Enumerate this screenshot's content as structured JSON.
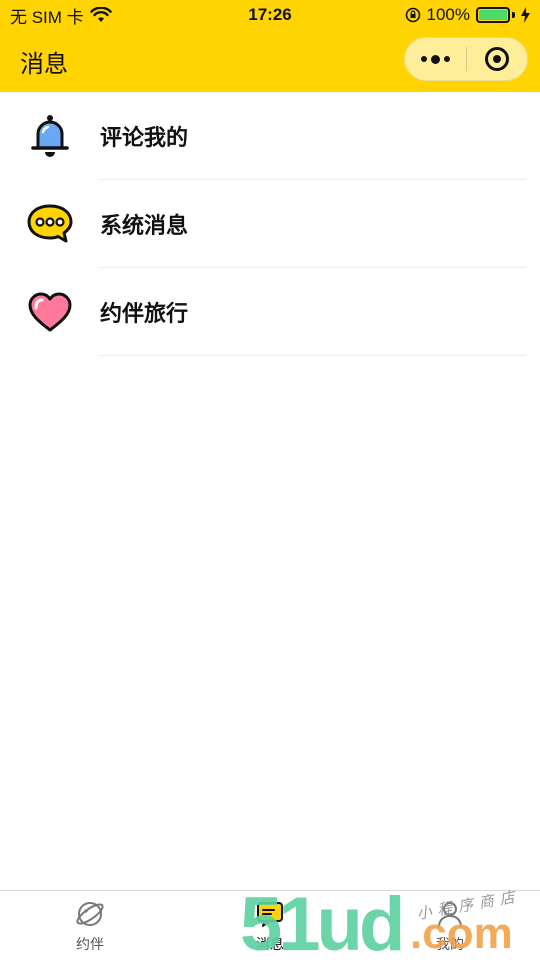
{
  "status_bar": {
    "carrier": "无 SIM 卡",
    "time": "17:26",
    "battery_percent": "100%",
    "battery_level": 1.0
  },
  "nav": {
    "title": "消息"
  },
  "messages": [
    {
      "label": "评论我的",
      "icon": "bell-icon"
    },
    {
      "label": "系统消息",
      "icon": "chat-bubble-icon"
    },
    {
      "label": "约伴旅行",
      "icon": "heart-icon"
    }
  ],
  "tabs": [
    {
      "label": "约伴",
      "icon": "planet-icon",
      "active": false
    },
    {
      "label": "消息",
      "icon": "message-icon",
      "active": true
    },
    {
      "label": "我的",
      "icon": "user-icon",
      "active": false
    }
  ],
  "watermark": {
    "brand": "51ud",
    "tld": ".com",
    "tagline": "小程序商店"
  },
  "colors": {
    "header": "#ffd400",
    "bell": "#6aa8f5",
    "bubble": "#ffd400",
    "heart": "#ff7a9a",
    "divider": "#eeeeee"
  }
}
